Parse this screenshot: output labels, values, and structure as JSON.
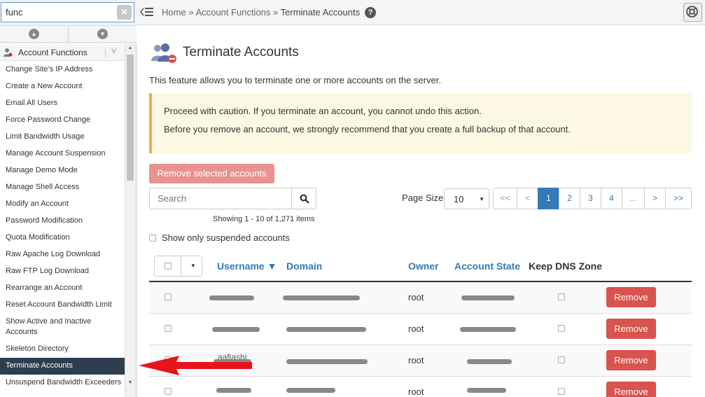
{
  "sidebar": {
    "search_value": "func",
    "clear_label": "×",
    "category": "Account Functions",
    "chevron": "V",
    "items": [
      {
        "label": "Change Site’s IP Address"
      },
      {
        "label": "Create a New Account"
      },
      {
        "label": "Email All Users"
      },
      {
        "label": "Force Password Change"
      },
      {
        "label": "Limit Bandwidth Usage"
      },
      {
        "label": "Manage Account Suspension"
      },
      {
        "label": "Manage Demo Mode"
      },
      {
        "label": "Manage Shell Access"
      },
      {
        "label": "Modify an Account"
      },
      {
        "label": "Password Modification"
      },
      {
        "label": "Quota Modification"
      },
      {
        "label": "Raw Apache Log Download"
      },
      {
        "label": "Raw FTP Log Download"
      },
      {
        "label": "Rearrange an Account"
      },
      {
        "label": "Reset Account Bandwidth Limit"
      },
      {
        "label": "Show Active and Inactive Accounts"
      },
      {
        "label": "Skeleton Directory"
      },
      {
        "label": "Terminate Accounts"
      },
      {
        "label": "Unsuspend Bandwidth Exceeders"
      }
    ]
  },
  "breadcrumb": {
    "home": "Home",
    "sep": "»",
    "section": "Account Functions",
    "current": "Terminate Accounts",
    "help": "?"
  },
  "page": {
    "title": "Terminate Accounts",
    "description": "This feature allows you to terminate one or more accounts on the server.",
    "warning_line1": "Proceed with caution. If you terminate an account, you cannot undo this action.",
    "warning_line2": "Before you remove an account, we strongly recommend that you create a full backup of that account.",
    "remove_selected": "Remove selected accounts",
    "search_placeholder": "Search",
    "showing": "Showing 1 - 10 of 1,271 items",
    "page_size_label": "Page Size",
    "page_size_value": "10",
    "show_suspended": "Show only suspended accounts"
  },
  "pagination": {
    "first": "<<",
    "prev": "<",
    "pages": [
      "1",
      "2",
      "3",
      "4"
    ],
    "ellipsis": "...",
    "next": ">",
    "last": ">>"
  },
  "table": {
    "columns": {
      "username": "Username ▼",
      "domain": "Domain",
      "owner": "Owner",
      "state": "Account State",
      "keep_dns": "Keep DNS Zone"
    },
    "rows": [
      {
        "owner": "root",
        "username_hint": "",
        "domain_hint": "",
        "remove": "Remove"
      },
      {
        "owner": "root",
        "username_hint": "",
        "domain_hint": "",
        "remove": "Remove"
      },
      {
        "owner": "root",
        "username_hint": "aafiashi",
        "domain_hint": "",
        "remove": "Remove"
      },
      {
        "owner": "root",
        "username_hint": "",
        "domain_hint": "",
        "remove": "Remove"
      }
    ]
  },
  "colors": {
    "accent": "#337ab7",
    "danger": "#d9534f",
    "danger_disabled": "#e9928f",
    "warning_bg": "#fcf8e3",
    "warning_border": "#f0ad4e",
    "sidebar_active": "#2d3e4f",
    "annotation_arrow": "#e8141b"
  },
  "icons": {
    "clear": "clear-icon",
    "menu": "menu-toggle-icon",
    "help": "help-icon",
    "support": "lifebuoy-icon",
    "title": "terminate-users-icon",
    "search": "search-icon"
  }
}
